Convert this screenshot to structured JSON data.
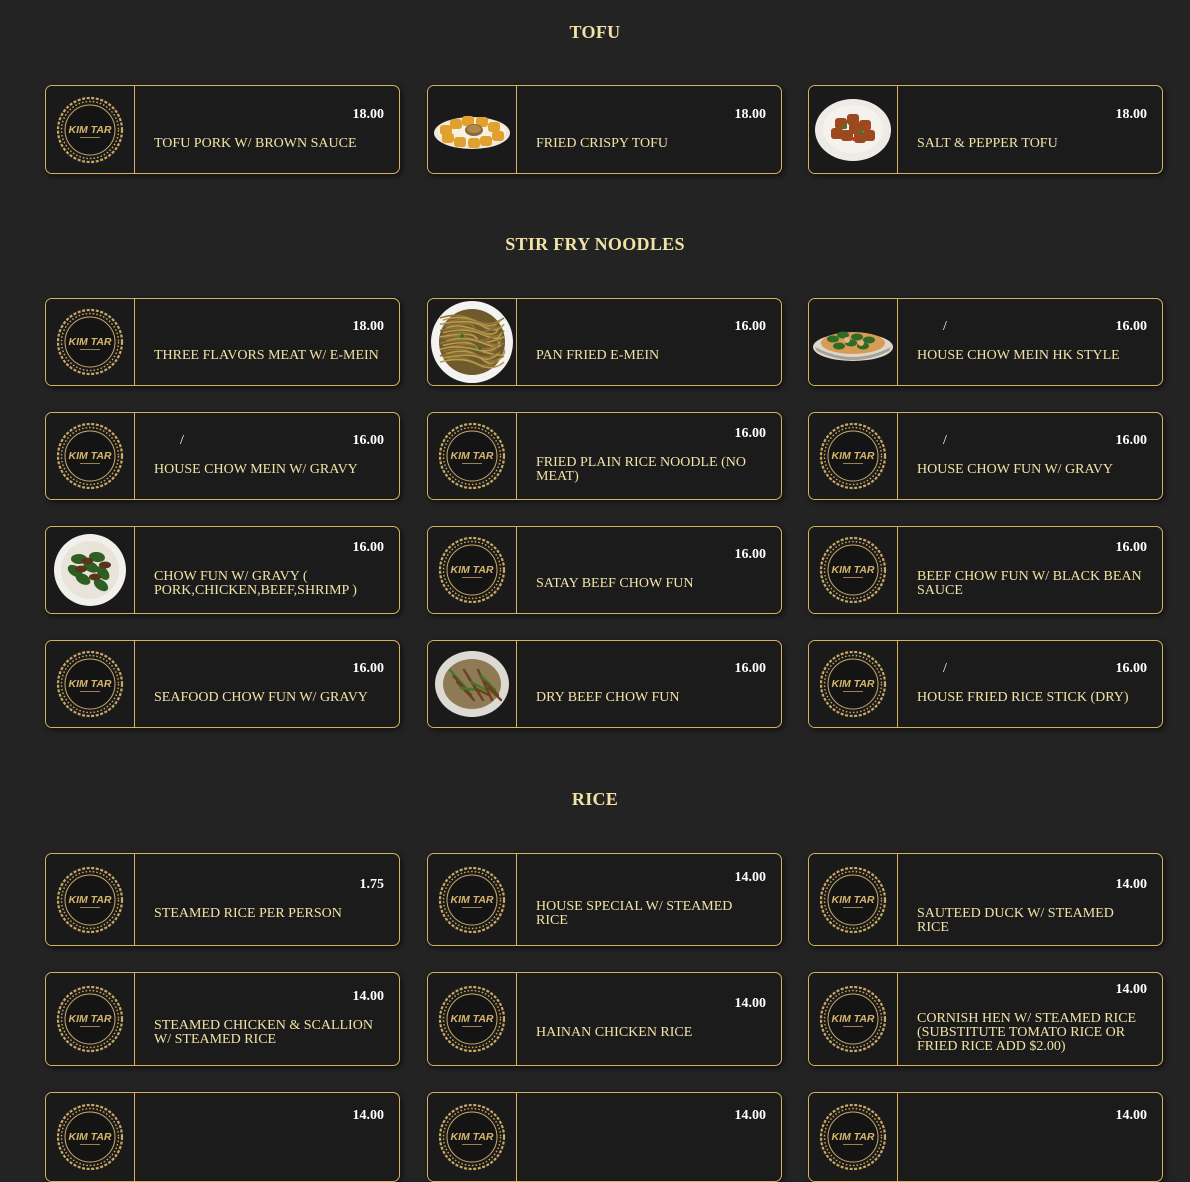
{
  "sections": {
    "tofu": {
      "title": "TOFU"
    },
    "noodles": {
      "title": "STIR FRY NOODLES"
    },
    "rice": {
      "title": "RICE"
    }
  },
  "logo_text": "KIM TAR",
  "logo_color": "#c9a864",
  "accent_border": "#d7b15f",
  "tofu_items": [
    {
      "name": "TOFU PORK W/ BROWN SAUCE",
      "price": "18.00",
      "image": "logo"
    },
    {
      "name": "FRIED CRISPY TOFU",
      "price": "18.00",
      "image": "fried-tofu-photo"
    },
    {
      "name": "SALT & PEPPER TOFU",
      "price": "18.00",
      "image": "salt-pepper-tofu-photo"
    }
  ],
  "noodle_items": [
    {
      "name": "THREE FLAVORS MEAT W/ E-MEIN",
      "price": "18.00",
      "image": "logo"
    },
    {
      "name": "PAN FRIED E-MEIN",
      "price": "16.00",
      "image": "noodle-photo"
    },
    {
      "name": "HOUSE CHOW MEIN HK STYLE",
      "price": "16.00",
      "image": "chow-mein-photo",
      "slash": "/"
    },
    {
      "name": "HOUSE CHOW MEIN W/ GRAVY",
      "price": "16.00",
      "image": "logo",
      "slash": "/"
    },
    {
      "name": "FRIED PLAIN RICE NOODLE (NO MEAT)",
      "price": "16.00",
      "image": "logo"
    },
    {
      "name": "HOUSE CHOW FUN W/ GRAVY",
      "price": "16.00",
      "image": "logo",
      "slash": "/"
    },
    {
      "name": "CHOW FUN W/ GRAVY ( PORK,CHICKEN,BEEF,SHRIMP )",
      "price": "16.00",
      "image": "chow-fun-photo"
    },
    {
      "name": "SATAY BEEF CHOW FUN",
      "price": "16.00",
      "image": "logo"
    },
    {
      "name": "BEEF CHOW FUN W/ BLACK BEAN SAUCE",
      "price": "16.00",
      "image": "logo"
    },
    {
      "name": "SEAFOOD CHOW FUN W/ GRAVY",
      "price": "16.00",
      "image": "logo"
    },
    {
      "name": "DRY BEEF CHOW FUN",
      "price": "16.00",
      "image": "dry-beef-photo"
    },
    {
      "name": "HOUSE FRIED RICE STICK (DRY)",
      "price": "16.00",
      "image": "logo",
      "slash": "/"
    }
  ],
  "rice_items": [
    {
      "name": "STEAMED RICE PER PERSON",
      "price": "1.75",
      "image": "logo"
    },
    {
      "name": "HOUSE SPECIAL W/ STEAMED RICE",
      "price": "14.00",
      "image": "logo"
    },
    {
      "name": "SAUTEED DUCK W/ STEAMED RICE",
      "price": "14.00",
      "image": "logo"
    },
    {
      "name": "STEAMED CHICKEN & SCALLION W/ STEAMED RICE",
      "price": "14.00",
      "image": "logo"
    },
    {
      "name": "HAINAN CHICKEN RICE",
      "price": "14.00",
      "image": "logo"
    },
    {
      "name": "CORNISH HEN W/ STEAMED RICE (SUBSTITUTE TOMATO RICE OR FRIED RICE ADD $2.00)",
      "price": "14.00",
      "image": "logo"
    },
    {
      "name": "",
      "price": "14.00",
      "image": "logo"
    },
    {
      "name": "",
      "price": "14.00",
      "image": "logo"
    },
    {
      "name": "",
      "price": "14.00",
      "image": "logo"
    }
  ]
}
